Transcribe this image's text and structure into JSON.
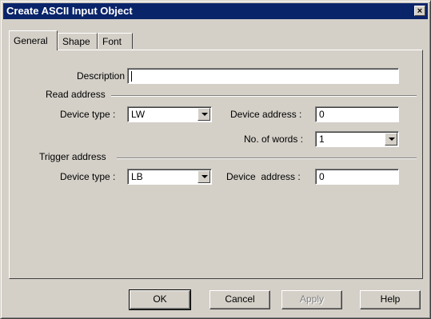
{
  "window": {
    "title": "Create ASCII Input Object",
    "close_symbol": "×"
  },
  "tabs": [
    {
      "label": "General",
      "active": true
    },
    {
      "label": "Shape",
      "active": false
    },
    {
      "label": "Font",
      "active": false
    }
  ],
  "general": {
    "description_label": "Description :",
    "description_value": "",
    "read_group": "Read address",
    "read_device_type_label": "Device type :",
    "read_device_type_value": "LW",
    "read_device_address_label": "Device address :",
    "read_device_address_value": "0",
    "words_label": "No. of words :",
    "words_value": "1",
    "trigger_group": "Trigger address",
    "trigger_device_type_label": "Device type :",
    "trigger_device_type_value": "LB",
    "trigger_device_address_label": "Device  address :",
    "trigger_device_address_value": "0"
  },
  "buttons": {
    "ok": "OK",
    "cancel": "Cancel",
    "apply": "Apply",
    "help": "Help"
  },
  "icons": {
    "close": "close-icon",
    "dropdown": "chevron-down-icon"
  }
}
